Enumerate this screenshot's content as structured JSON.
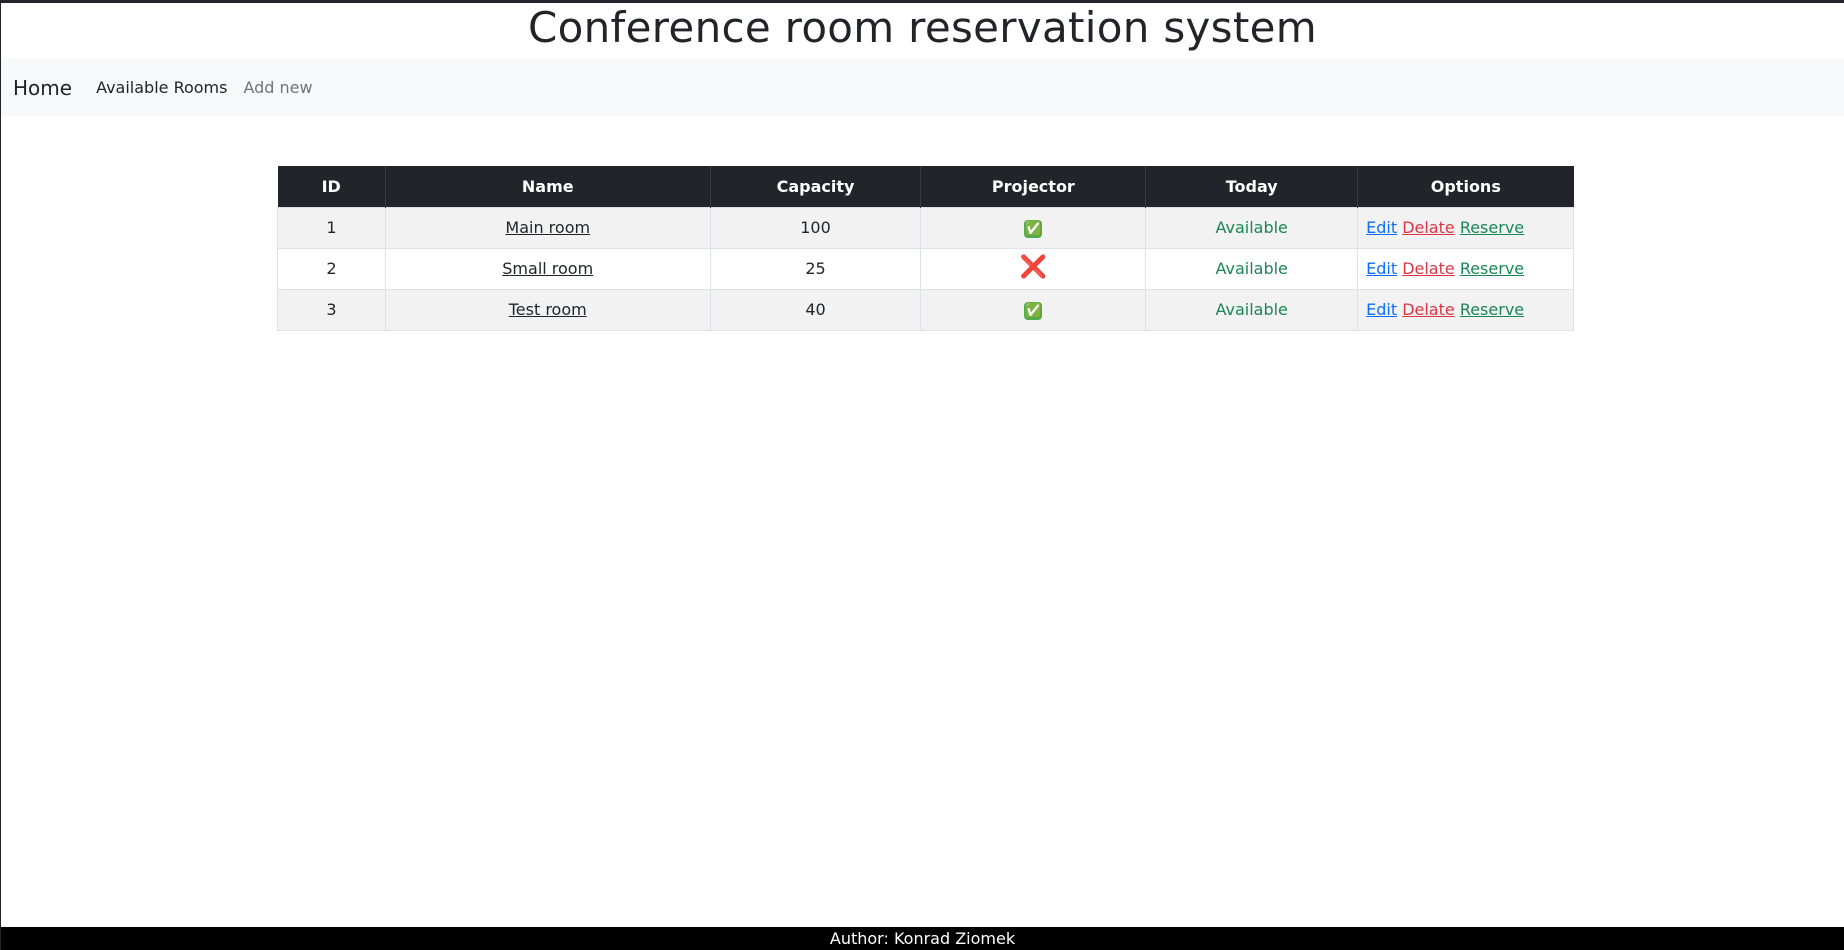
{
  "header": {
    "title": "Conference room reservation system"
  },
  "nav": {
    "brand": "Home",
    "links": [
      {
        "label": "Available Rooms",
        "muted": false
      },
      {
        "label": "Add new",
        "muted": true
      }
    ]
  },
  "table": {
    "columns": [
      "ID",
      "Name",
      "Capacity",
      "Projector",
      "Today",
      "Options"
    ],
    "rows": [
      {
        "id": "1",
        "name": "Main room",
        "capacity": "100",
        "projector": true,
        "today": "Available"
      },
      {
        "id": "2",
        "name": "Small room",
        "capacity": "25",
        "projector": false,
        "today": "Available"
      },
      {
        "id": "3",
        "name": "Test room",
        "capacity": "40",
        "projector": true,
        "today": "Available"
      }
    ],
    "options": {
      "edit": "Edit",
      "delete": "Delate",
      "reserve": "Reserve"
    },
    "projector_icons": {
      "yes": "✅",
      "no": "❌"
    }
  },
  "footer": {
    "text": "Author: Konrad Ziomek"
  },
  "colors": {
    "header_bg": "#212529",
    "available": "#198754",
    "edit": "#0d6efd",
    "delete": "#dc3545",
    "reserve": "#198754"
  }
}
